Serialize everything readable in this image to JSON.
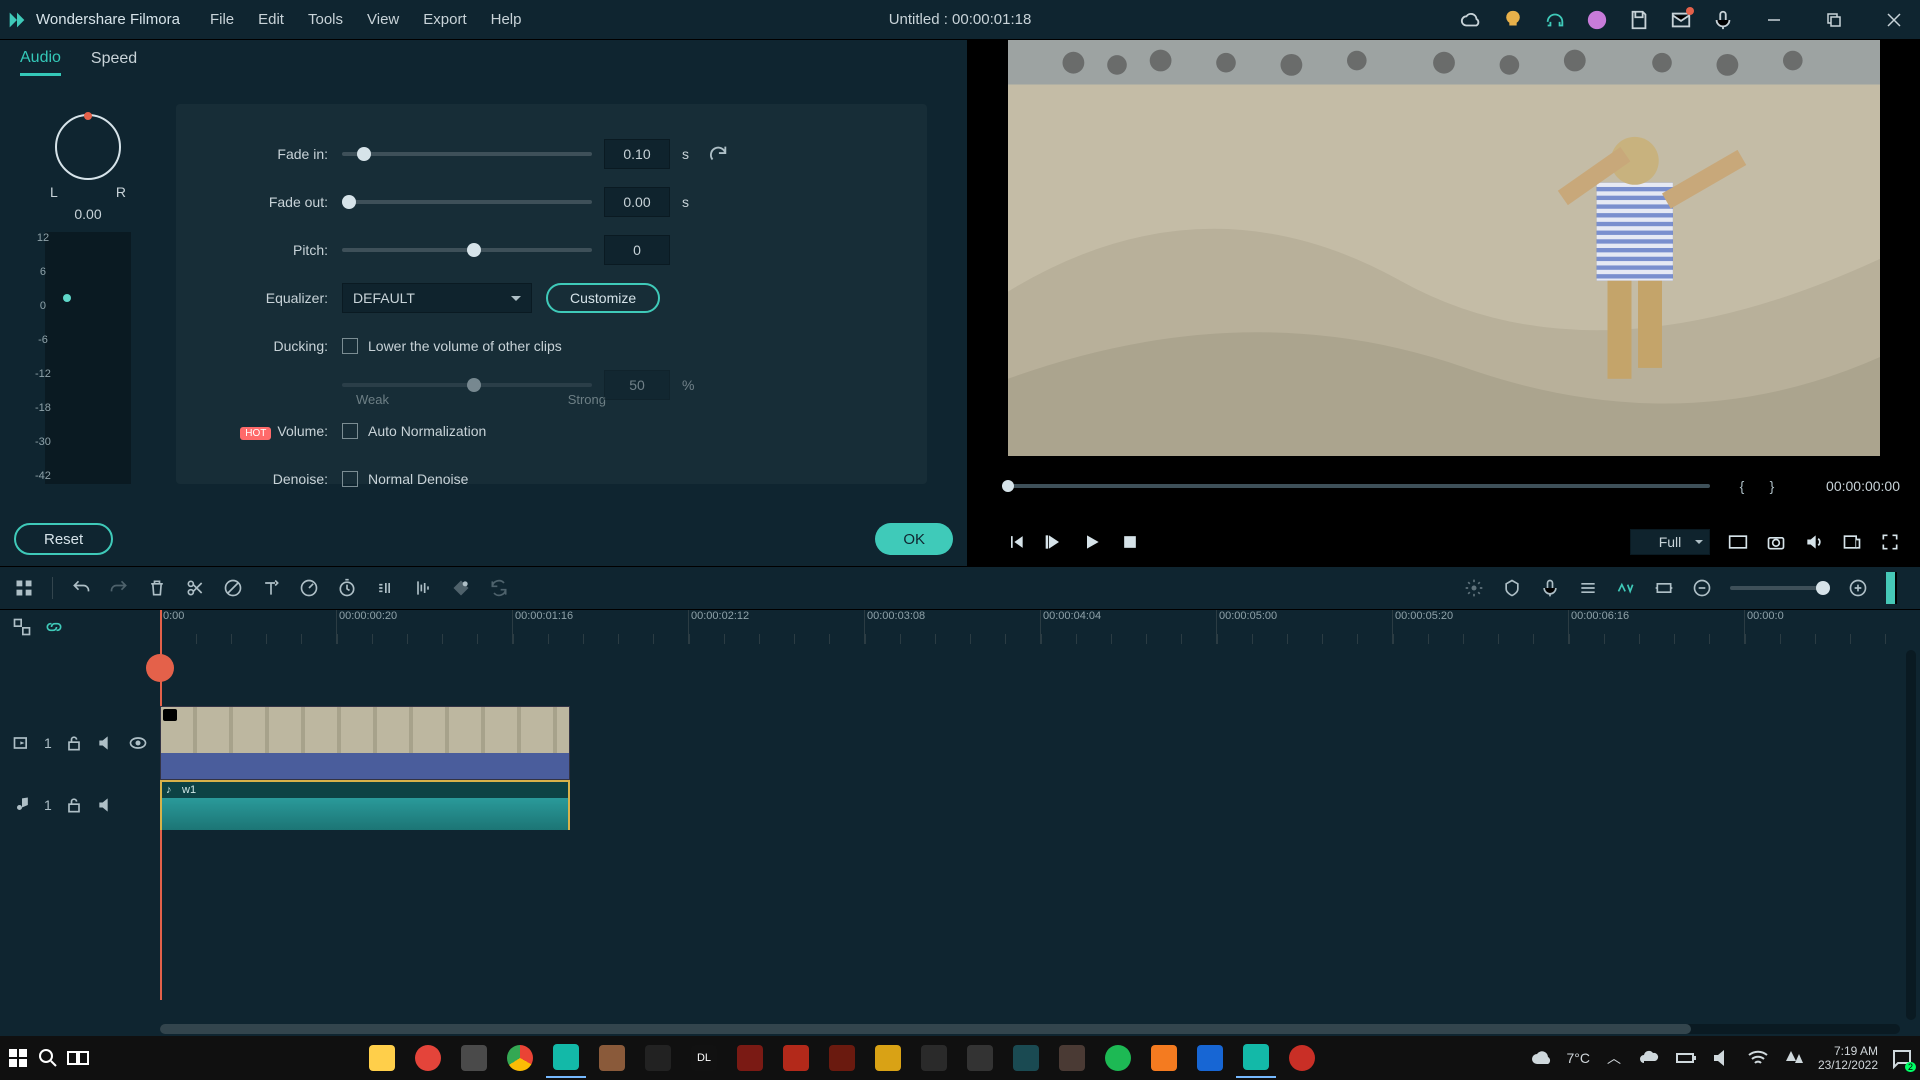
{
  "titlebar": {
    "app_name": "Wondershare Filmora",
    "menus": [
      "File",
      "Edit",
      "Tools",
      "View",
      "Export",
      "Help"
    ],
    "doc_title": "Untitled : 00:00:01:18"
  },
  "tabs": {
    "audio": "Audio",
    "speed": "Speed"
  },
  "balance": {
    "L": "L",
    "R": "R",
    "value": "0.00"
  },
  "meter_scale": [
    "12",
    "6",
    "0",
    "-6",
    "-12",
    "-18",
    "-30",
    "-42"
  ],
  "audio": {
    "fade_in": {
      "label": "Fade in:",
      "value": "0.10",
      "unit": "s",
      "thumb_pct": 6
    },
    "fade_out": {
      "label": "Fade out:",
      "value": "0.00",
      "unit": "s",
      "thumb_pct": 0
    },
    "pitch": {
      "label": "Pitch:",
      "value": "0",
      "thumb_pct": 50
    },
    "equalizer": {
      "label": "Equalizer:",
      "value": "DEFAULT",
      "customize": "Customize"
    },
    "ducking": {
      "label": "Ducking:",
      "checkbox": "Lower the volume of other clips",
      "amount": "50",
      "unit": "%",
      "weak": "Weak",
      "strong": "Strong"
    },
    "volume": {
      "hot": "HOT",
      "label": "Volume:",
      "checkbox": "Auto Normalization"
    },
    "denoise": {
      "label": "Denoise:",
      "checkbox": "Normal Denoise"
    }
  },
  "buttons": {
    "reset": "Reset",
    "ok": "OK"
  },
  "preview": {
    "timecode": "00:00:00:00",
    "zoom": "Full",
    "mark_in": "{",
    "mark_out": "}"
  },
  "ruler": [
    "0:00",
    "00:00:00:20",
    "00:00:01:16",
    "00:00:02:12",
    "00:00:03:08",
    "00:00:04:04",
    "00:00:05:00",
    "00:00:05:20",
    "00:00:06:16",
    "00:00:0"
  ],
  "track_video": {
    "id": "1"
  },
  "track_audio": {
    "id": "1",
    "clip_name": "w1"
  },
  "system": {
    "temp": "7°C",
    "time": "7:19 AM",
    "date": "23/12/2022",
    "notif": "2"
  }
}
